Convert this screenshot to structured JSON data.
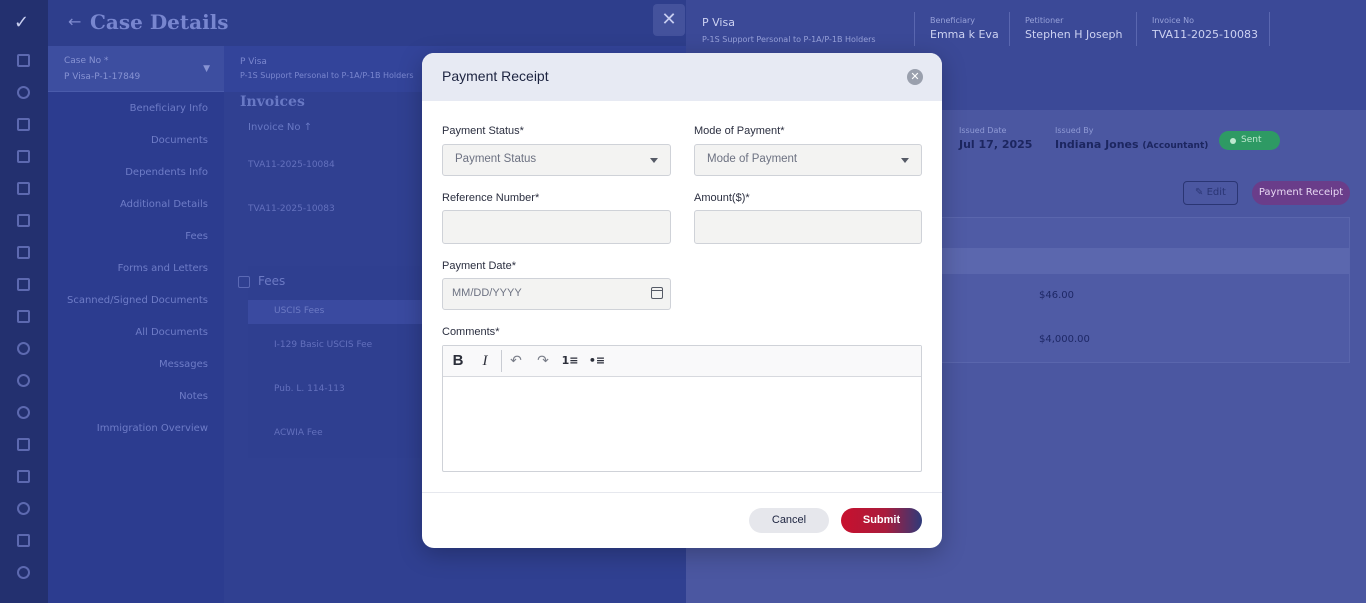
{
  "background": {
    "page_title": "Case Details",
    "case_selector": {
      "label": "Case No *",
      "value": "P Visa-P-1-17849"
    },
    "case_summary": {
      "visa": "P Visa",
      "subtitle": "P-1S Support Personal to P-1A/P-1B Holders"
    },
    "side_nav": [
      "Beneficiary Info",
      "Documents",
      "Dependents Info",
      "Additional Details",
      "Fees",
      "Forms and Letters",
      "Scanned/Signed Documents",
      "All Documents",
      "Messages",
      "Notes",
      "Immigration Overview"
    ],
    "invoices": {
      "title": "Invoices",
      "header": "Invoice No ↑",
      "rows": [
        "TVA11-2025-10084",
        "TVA11-2025-10083"
      ]
    },
    "fees": {
      "title": "Fees",
      "group": "USCIS Fees",
      "items": [
        "I-129 Basic USCIS Fee",
        "Pub. L. 114-113",
        "ACWIA Fee"
      ]
    },
    "right_panel": {
      "visa": "P Visa",
      "visa_sub": "P-1S Support Personal to P-1A/P-1B Holders",
      "beneficiary_label": "Beneficiary",
      "beneficiary": "Emma k Eva",
      "petitioner_label": "Petitioner",
      "petitioner": "Stephen H Joseph",
      "invoice_no_label": "Invoice No",
      "invoice_no": "TVA11-2025-10083",
      "issued_date_label": "Issued Date",
      "issued_date": "Jul 17, 2025",
      "issued_by_label": "Issued By",
      "issued_by": "Indiana Jones",
      "issued_by_role": "(Accountant)",
      "status": "Sent",
      "edit_label": "Edit",
      "payment_receipt_label": "Payment Receipt",
      "amounts": [
        "$46.00",
        "$4,000.00"
      ]
    },
    "close_glyph": "✕"
  },
  "modal": {
    "title": "Payment Receipt",
    "close_glyph": "✕",
    "payment_status": {
      "label": "Payment Status",
      "placeholder": "Payment Status"
    },
    "mode_of_payment": {
      "label": "Mode of Payment",
      "placeholder": "Mode of Payment"
    },
    "reference_number": {
      "label": "Reference Number",
      "value": ""
    },
    "amount": {
      "label": "Amount($)",
      "value": ""
    },
    "payment_date": {
      "label": "Payment Date",
      "placeholder": "MM/DD/YYYY"
    },
    "comments": {
      "label": "Comments"
    },
    "required_marker": "*",
    "toolbar": {
      "bold": "B",
      "italic": "I",
      "undo": "↶",
      "redo": "↷",
      "ordered_list": "1≡",
      "bullet_list": "•≡"
    },
    "cancel_label": "Cancel",
    "submit_label": "Submit"
  },
  "colors": {
    "overlay_tint": "#2a3a8a",
    "submit_gradient_start": "#c8102e",
    "submit_gradient_end": "#2e3a7a",
    "sent_badge": "#2e9a64"
  }
}
